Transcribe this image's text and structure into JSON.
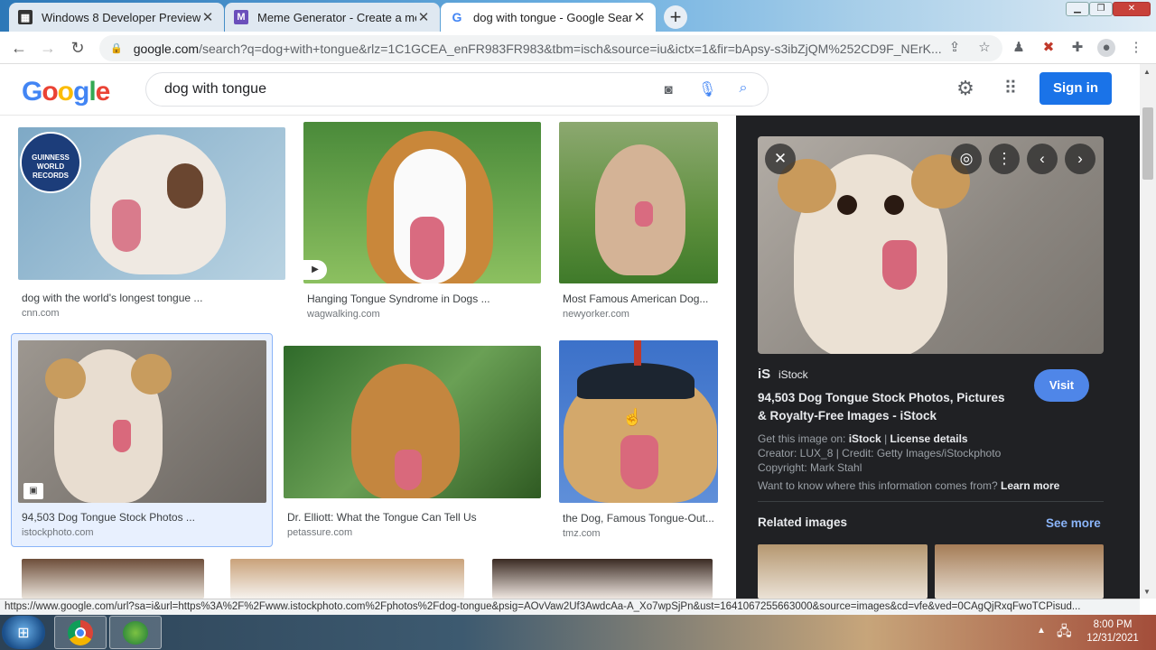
{
  "browser": {
    "tabs": [
      {
        "title": "Windows 8 Developer Preview (3",
        "icon": "ie-page-icon"
      },
      {
        "title": "Meme Generator - Create a mem",
        "icon": "meme-icon"
      },
      {
        "title": "dog with tongue - Google Searc",
        "icon": "google-g-icon"
      }
    ],
    "new_tab": "+",
    "url_host": "google.com",
    "url_path": "/search?q=dog+with+tongue&rlz=1C1GCEA_enFR983FR983&tbm=isch&source=iu&ictx=1&fir=bApsy-s3ibZjQM%252CD9F_NErK..."
  },
  "google": {
    "logo": "Google",
    "query": "dog with tongue",
    "signin": "Sign in"
  },
  "results": [
    {
      "caption": "dog with the world's longest tongue ...",
      "source": "cnn.com"
    },
    {
      "caption": "Hanging Tongue Syndrome in Dogs ...",
      "source": "wagwalking.com"
    },
    {
      "caption": "Most Famous American Dog...",
      "source": "newyorker.com"
    },
    {
      "caption": "94,503 Dog Tongue Stock Photos ...",
      "source": "istockphoto.com"
    },
    {
      "caption": "Dr. Elliott: What the Tongue Can Tell Us",
      "source": "petassure.com"
    },
    {
      "caption": "the Dog, Famous Tongue-Out...",
      "source": "tmz.com"
    }
  ],
  "panel": {
    "site": "iStock",
    "site_logo": "iS",
    "visit": "Visit",
    "title_line1": "94,503 Dog Tongue Stock Photos, Pictures",
    "title_line2": "& Royalty-Free Images - iStock",
    "get_image_prefix": "Get this image on: ",
    "get_image_site": "iStock",
    "separator": " | ",
    "license": "License details",
    "creator": "Creator: LUX_8 | Credit: Getty Images/iStockphoto",
    "copyright": "Copyright: Mark Stahl",
    "info_question": "Want to know where this information comes from? ",
    "learn_more": "Learn more",
    "related": "Related images",
    "see_more": "See more"
  },
  "status_url": "https://www.google.com/url?sa=i&url=https%3A%2F%2Fwww.istockphoto.com%2Fphotos%2Fdog-tongue&psig=AOvVaw2Uf3AwdcAa-A_Xo7wpSjPn&ust=1641067255663000&source=images&cd=vfe&ved=0CAgQjRxqFwoTCPisud...",
  "taskbar": {
    "time": "8:00 PM",
    "date": "12/31/2021"
  }
}
